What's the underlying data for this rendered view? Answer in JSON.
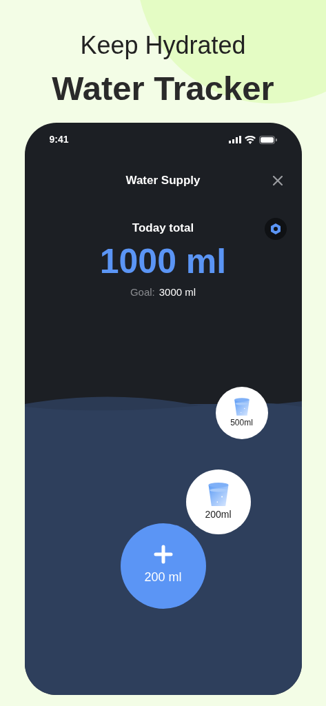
{
  "headline": {
    "subtitle": "Keep Hydrated",
    "title": "Water Tracker"
  },
  "status_bar": {
    "time": "9:41"
  },
  "header": {
    "title": "Water Supply"
  },
  "summary": {
    "label": "Today total",
    "total": "1000 ml",
    "goal_label": "Goal:",
    "goal_value": "3000 ml"
  },
  "quick_adds": [
    {
      "label": "500ml",
      "kind": "small"
    },
    {
      "label": "200ml",
      "kind": "large"
    }
  ],
  "add_button": {
    "label": "200 ml"
  }
}
